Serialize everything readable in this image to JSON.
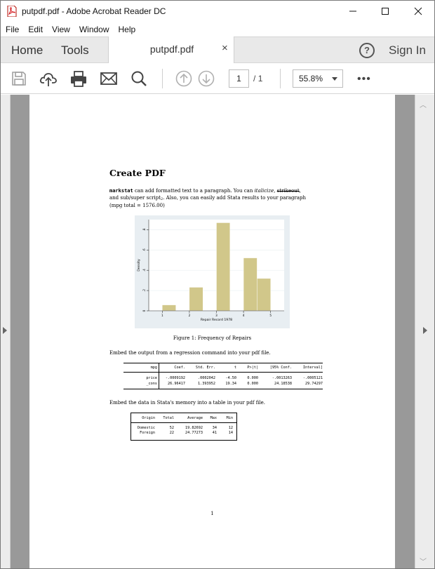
{
  "window": {
    "title": "putpdf.pdf - Adobe Acrobat Reader DC",
    "minimize": "—",
    "maximize": "☐",
    "close": "✕"
  },
  "menu": [
    "File",
    "Edit",
    "View",
    "Window",
    "Help"
  ],
  "tabs": {
    "home": "Home",
    "tools": "Tools",
    "document": "putpdf.pdf",
    "close": "×",
    "help": "?",
    "sign_in": "Sign In"
  },
  "toolbar": {
    "icons": [
      "save-icon",
      "upload-cloud-icon",
      "print-icon",
      "email-icon",
      "search-icon",
      "page-up-icon",
      "page-down-icon"
    ],
    "page_current": "1",
    "page_separator": "/",
    "page_total": "1",
    "zoom": "55.8%",
    "more": "•••"
  },
  "document": {
    "heading": "Create PDF",
    "para": {
      "cmd": "markstat",
      "t1": " can add formatted text to a paragraph. You can ",
      "italic": "italicize",
      "t2": ", ",
      "strike": "strikeout",
      "t3": ",",
      "t4": "and sub/super script",
      "subscript": "2",
      "t5": ". Also, you can easily add Stata results to your paragraph",
      "t6": "(mpg total = 1576.00)"
    },
    "figure_caption": "Figure 1: Frequency of Repairs",
    "text_regression": "Embed the output from a regression command into your pdf file.",
    "text_data": "Embed the data in Stata's memory into a table in your pdf file.",
    "page_number": "1"
  },
  "chart_data": {
    "type": "bar",
    "xlabel": "Repair Record 1978",
    "ylabel": "Density",
    "x_ticks": [
      "1",
      "2",
      "3",
      "4",
      "5"
    ],
    "y_ticks": [
      "0",
      ".2",
      ".4",
      ".6",
      ".8"
    ],
    "xlim": [
      0.5,
      5.5
    ],
    "ylim": [
      0,
      0.9
    ],
    "bin_width": 0.5,
    "bars": [
      {
        "x_start": 1.0,
        "value": 0.058
      },
      {
        "x_start": 2.0,
        "value": 0.232
      },
      {
        "x_start": 3.0,
        "value": 0.869
      },
      {
        "x_start": 3.5,
        "value": 0.0
      },
      {
        "x_start": 4.0,
        "value": 0.522
      },
      {
        "x_start": 4.5,
        "value": 0.319
      }
    ],
    "bar_color": "#d1c78a",
    "plot_background": "#ffffff",
    "outer_background": "#e8eef2"
  },
  "regression_table": {
    "header": [
      "mpg",
      "Coef.",
      "Std. Err.",
      "t",
      "P>|t|",
      "[95% Conf.",
      "Interval]"
    ],
    "rows": [
      [
        "price",
        "-.0009192",
        ".0002042",
        "-4.50",
        "0.000",
        "-.0013263",
        "-.0005121"
      ],
      [
        "_cons",
        "26.96417",
        "1.393952",
        "19.34",
        "0.000",
        "24.18538",
        "29.74297"
      ]
    ]
  },
  "data_table": {
    "header": [
      "Origin",
      "Total",
      "Average",
      "Max",
      "Min"
    ],
    "rows": [
      [
        "Domestic",
        "52",
        "19.82692",
        "34",
        "12"
      ],
      [
        "Foreign",
        "22",
        "24.77273",
        "41",
        "14"
      ]
    ]
  }
}
